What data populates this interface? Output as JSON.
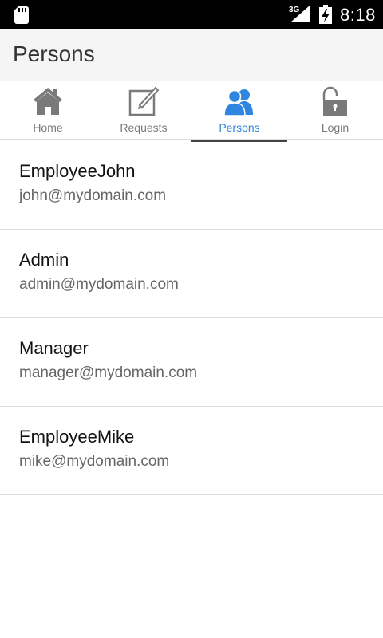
{
  "status_bar": {
    "network": "3G",
    "time": "8:18",
    "icons": [
      "sd-card-icon",
      "signal-icon",
      "battery-charging-icon"
    ]
  },
  "header": {
    "title": "Persons"
  },
  "tabs": [
    {
      "label": "Home",
      "icon": "home-icon",
      "active": false
    },
    {
      "label": "Requests",
      "icon": "edit-icon",
      "active": false
    },
    {
      "label": "Persons",
      "icon": "people-icon",
      "active": true
    },
    {
      "label": "Login",
      "icon": "unlocked-padlock-icon",
      "active": false
    }
  ],
  "persons": [
    {
      "name": "EmployeeJohn",
      "email": "john@mydomain.com"
    },
    {
      "name": "Admin",
      "email": "admin@mydomain.com"
    },
    {
      "name": "Manager",
      "email": "manager@mydomain.com"
    },
    {
      "name": "EmployeeMike",
      "email": "mike@mydomain.com"
    }
  ],
  "colors": {
    "accent": "#2e86e0",
    "inactive_icon": "#7a7a7a",
    "status_bar": "#000000",
    "title_bar": "#f5f5f5"
  }
}
